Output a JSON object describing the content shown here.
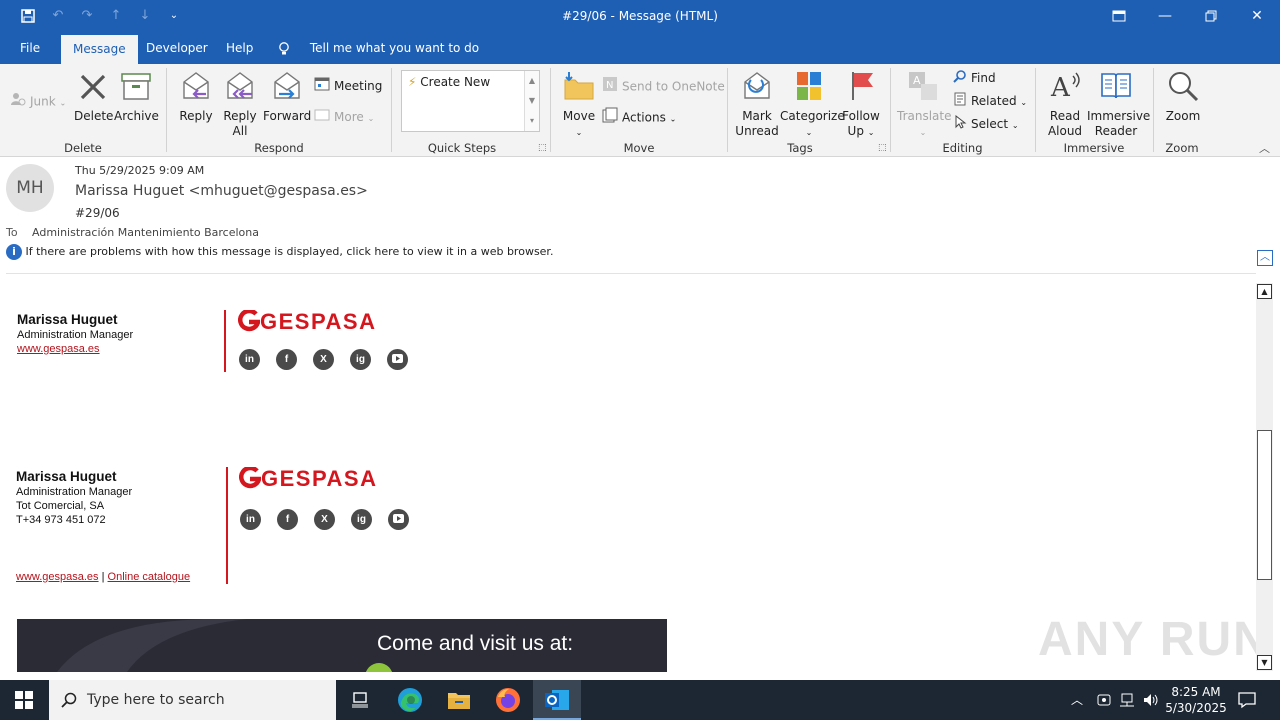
{
  "window": {
    "title": "#29/06  -  Message (HTML)",
    "controls": [
      "restore-ribbon",
      "minimize",
      "maximize",
      "close"
    ]
  },
  "menu": {
    "tabs": [
      "File",
      "Message",
      "Developer",
      "Help"
    ],
    "active_tab": "Message",
    "tell_me": "Tell me what you want to do"
  },
  "ribbon": {
    "delete_group": {
      "label": "Delete",
      "junk": "Junk",
      "delete": "Delete",
      "archive": "Archive"
    },
    "respond_group": {
      "label": "Respond",
      "reply": "Reply",
      "reply_all_1": "Reply",
      "reply_all_2": "All",
      "forward": "Forward",
      "meeting": "Meeting",
      "more": "More"
    },
    "quicksteps_group": {
      "label": "Quick Steps",
      "create_new": "Create New"
    },
    "move_group": {
      "label": "Move",
      "move": "Move",
      "onenote": "Send to OneNote",
      "actions": "Actions"
    },
    "tags_group": {
      "label": "Tags",
      "mark_1": "Mark",
      "mark_2": "Unread",
      "categorize": "Categorize",
      "follow_1": "Follow",
      "follow_2": "Up"
    },
    "editing_group": {
      "label": "Editing",
      "translate": "Translate",
      "find": "Find",
      "related": "Related",
      "select": "Select"
    },
    "immersive_group": {
      "label": "Immersive",
      "read_1": "Read",
      "read_2": "Aloud",
      "reader_1": "Immersive",
      "reader_2": "Reader"
    },
    "zoom_group": {
      "label": "Zoom",
      "zoom": "Zoom"
    }
  },
  "message": {
    "avatar_initials": "MH",
    "date": "Thu 5/29/2025 9:09 AM",
    "from": "Marissa Huguet <mhuguet@gespasa.es>",
    "subject": "#29/06",
    "to_label": "To",
    "to": "Administración Mantenimiento Barcelona",
    "info_bar": "If there are problems with how this message is displayed, click here to view it in a web browser."
  },
  "signature1": {
    "name": "Marissa Huguet",
    "role": "Administration Manager",
    "link": "www.gespasa.es",
    "brand": "GESPASA"
  },
  "signature2": {
    "name": "Marissa Huguet",
    "role": "Administration Manager",
    "company": "Tot Comercial, SA",
    "phone": "T+34 973 451 072",
    "link1": "www.gespasa.es",
    "separator": "|",
    "link2": "Online catalogue",
    "brand": "GESPASA"
  },
  "social_icons": [
    "in",
    "f",
    "X",
    "ig",
    "yt"
  ],
  "banner": {
    "text": "Come and visit us at:"
  },
  "watermark": "ANY RUN",
  "taskbar": {
    "search_placeholder": "Type here to search",
    "time": "8:25 AM",
    "date": "5/30/2025"
  },
  "colors": {
    "accent": "#1e5fb4",
    "brand_red": "#d4171e",
    "taskbar": "#1c2733"
  }
}
